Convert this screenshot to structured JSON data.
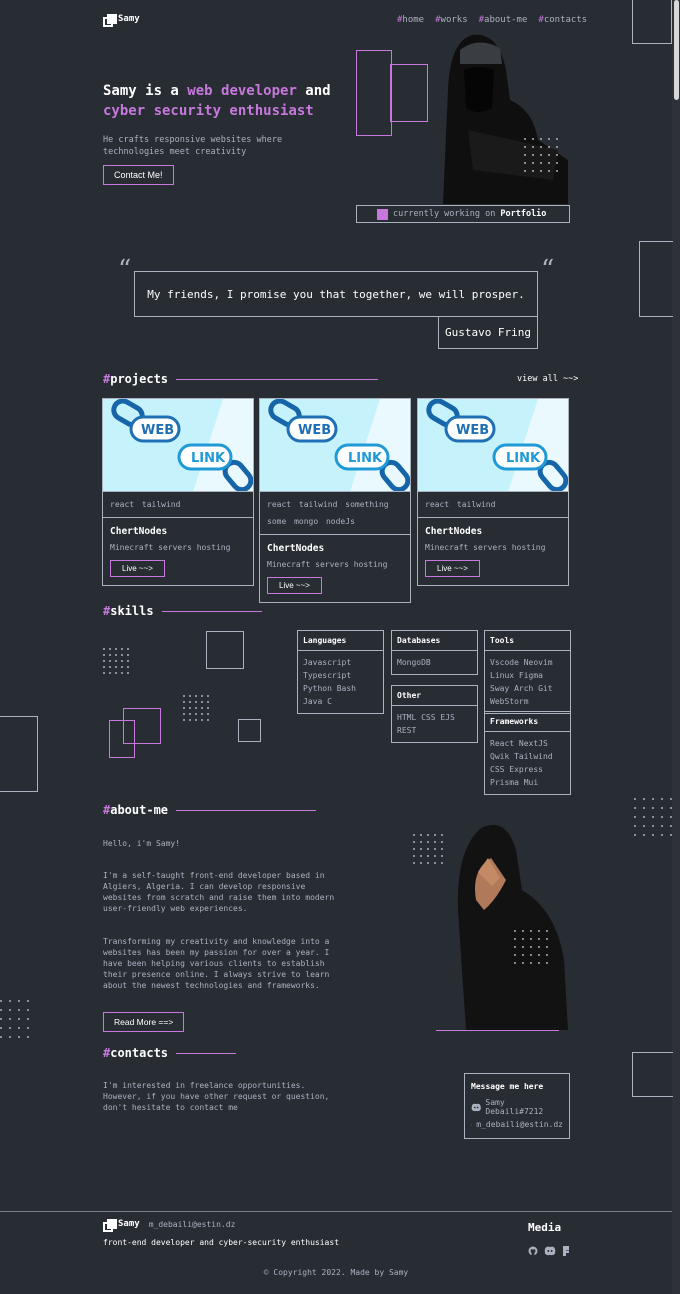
{
  "header": {
    "logo_text": "Samy",
    "nav": [
      {
        "hash": "#",
        "label": "home"
      },
      {
        "hash": "#",
        "label": "works"
      },
      {
        "hash": "#",
        "label": "about-me"
      },
      {
        "hash": "#",
        "label": "contacts"
      }
    ]
  },
  "hero": {
    "title_part1": "Samy is a ",
    "title_accent1": "web developer",
    "title_part2": " and",
    "title_accent2": "cyber security enthusiast",
    "subtitle": "He crafts responsive websites where technologies meet creativity",
    "cta_label": "Contact Me!",
    "status_prefix": "currently working on",
    "status_project": "Portfolio"
  },
  "quote": {
    "mark": "“",
    "text": "My friends, I promise you that together, we will prosper.",
    "author": "Gustavo Fring"
  },
  "projects": {
    "hash": "#",
    "title": "projects",
    "view_all": "view all ~~>",
    "cards": [
      {
        "img_text1": "WEB",
        "img_text2": "LINK",
        "tags": "react tailwind",
        "name": "ChertNodes",
        "desc": "Minecraft servers hosting",
        "live": "Live ~~>"
      },
      {
        "img_text1": "WEB",
        "img_text2": "LINK",
        "tags": "react tailwind something some mongo nodeJs",
        "name": "ChertNodes",
        "desc": "Minecraft servers hosting",
        "live": "Live ~~>"
      },
      {
        "img_text1": "WEB",
        "img_text2": "LINK",
        "tags": "react tailwind",
        "name": "ChertNodes",
        "desc": "Minecraft servers hosting",
        "live": "Live ~~>"
      }
    ]
  },
  "skills": {
    "hash": "#",
    "title": "skills",
    "languages": {
      "title": "Languages",
      "items": "Javascript Typescript Python Bash Java C"
    },
    "databases": {
      "title": "Databases",
      "items": "MongoDB"
    },
    "other": {
      "title": "Other",
      "items": "HTML CSS EJS REST"
    },
    "tools": {
      "title": "Tools",
      "items": "Vscode Neovim Linux Figma Sway Arch Git WebStorm"
    },
    "frameworks": {
      "title": "Frameworks",
      "items": "React NextJS Qwik Tailwind CSS Express Prisma Mui"
    }
  },
  "about": {
    "hash": "#",
    "title": "about-me",
    "greeting": "Hello, i'm Samy!",
    "p1": "I'm a self-taught front-end developer based in Algiers, Algeria. I can develop responsive websites from scratch and raise them into modern user-friendly web experiences.",
    "p2": "Transforming my creativity and knowledge into a websites has been my passion for over a year. I have been helping various clients to establish their presence online. I always strive to learn about the newest technologies and frameworks.",
    "read_more": "Read More ==>"
  },
  "contacts": {
    "hash": "#",
    "title": "contacts",
    "text": "I'm interested in freelance opportunities. However, if you have other request or question, don't hesitate to contact me",
    "box_title": "Message me here",
    "discord": "Samy Debaili#7212",
    "email": "m_debaili@estin.dz"
  },
  "footer": {
    "logo_text": "Samy",
    "email": "m_debaili@estin.dz",
    "tagline": "front-end developer and cyber-security enthusiast",
    "media_title": "Media",
    "copyright": "© Copyright 2022. Made by Samy"
  },
  "colors": {
    "background": "#282c33",
    "accent": "#c778dd",
    "text": "#abb2bf",
    "white": "#ffffff"
  }
}
